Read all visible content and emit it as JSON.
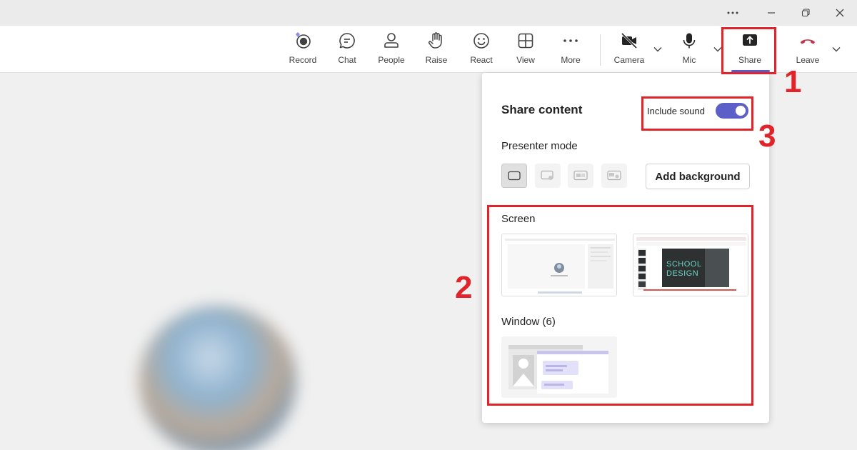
{
  "titlebar": {
    "icons": [
      "more-icon",
      "minimize-icon",
      "restore-icon",
      "close-icon"
    ]
  },
  "toolbar": {
    "record": "Record",
    "chat": "Chat",
    "people": "People",
    "raise": "Raise",
    "react": "React",
    "view": "View",
    "more": "More",
    "camera": "Camera",
    "mic": "Mic",
    "share": "Share",
    "leave": "Leave"
  },
  "share_panel": {
    "title": "Share content",
    "include_sound_label": "Include sound",
    "include_sound_on": true,
    "presenter_mode_label": "Presenter mode",
    "add_background_label": "Add background",
    "screen_label": "Screen",
    "window_label": "Window (6)",
    "screen_thumb_text": "SCHOOL\nDESIGN"
  },
  "annotations": {
    "one": "1",
    "two": "2",
    "three": "3"
  },
  "colors": {
    "accent": "#5b5fc7",
    "leave": "#c4314b",
    "annotation": "#e0242a"
  }
}
